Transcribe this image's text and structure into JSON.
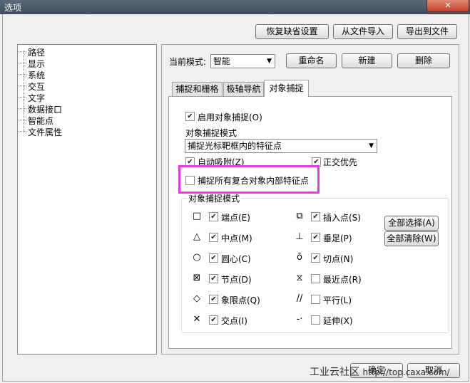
{
  "window": {
    "title": "选项",
    "close_glyph": "✕"
  },
  "top_buttons": {
    "restore": "恢复缺省设置",
    "import": "从文件导入",
    "export": "导出到文件"
  },
  "tree": {
    "items": [
      {
        "label": "路径"
      },
      {
        "label": "显示"
      },
      {
        "label": "系统"
      },
      {
        "label": "交互"
      },
      {
        "label": "文字"
      },
      {
        "label": "数据接口"
      },
      {
        "label": "智能点"
      },
      {
        "label": "文件属性"
      }
    ]
  },
  "mode": {
    "label": "当前模式:",
    "value": "智能",
    "rename": "重命名",
    "new": "新建",
    "delete": "删除"
  },
  "tabs": [
    {
      "label": "捕捉和栅格",
      "active": false
    },
    {
      "label": "极轴导航",
      "active": false
    },
    {
      "label": "对象捕捉",
      "active": true
    }
  ],
  "snap": {
    "enable_label": "启用对象捕捉(O)",
    "enable_checked": true,
    "mode_label": "对象捕捉模式",
    "mode_value": "捕捉光标靶框内的特征点",
    "auto_label": "自动吸附(Z)",
    "auto_checked": true,
    "ortho_label": "正交优先",
    "ortho_checked": true,
    "compound_label": "捕捉所有复合对象内部特征点",
    "compound_checked": false,
    "group_title": "对象捕捉模式",
    "select_all": "全部选择(A)",
    "clear_all": "全部清除(W)",
    "left_modes": [
      {
        "symbol": "□",
        "icon": "square-icon",
        "label": "端点(E)",
        "checked": true
      },
      {
        "symbol": "△",
        "icon": "triangle-icon",
        "label": "中点(M)",
        "checked": true
      },
      {
        "symbol": "○",
        "icon": "circle-icon",
        "label": "圆心(C)",
        "checked": true
      },
      {
        "symbol": "⊠",
        "icon": "node-icon",
        "label": "节点(D)",
        "checked": true
      },
      {
        "symbol": "◇",
        "icon": "diamond-icon",
        "label": "象限点(Q)",
        "checked": true
      },
      {
        "symbol": "✕",
        "icon": "cross-icon",
        "label": "交点(I)",
        "checked": true
      }
    ],
    "right_modes": [
      {
        "symbol": "⧉",
        "icon": "insert-icon",
        "label": "插入点(S)",
        "checked": true
      },
      {
        "symbol": "⊥",
        "icon": "perpendicular-icon",
        "label": "垂足(P)",
        "checked": true
      },
      {
        "symbol": "ō",
        "icon": "tangent-icon",
        "label": "切点(N)",
        "checked": true
      },
      {
        "symbol": "⧖",
        "icon": "nearest-icon",
        "label": "最近点(R)",
        "checked": false
      },
      {
        "symbol": "//",
        "icon": "parallel-icon",
        "label": "平行(L)",
        "checked": false
      },
      {
        "symbol": "-·",
        "icon": "extension-icon",
        "label": "延伸(X)",
        "checked": false
      }
    ]
  },
  "bottom_buttons": {
    "ok": "确定",
    "cancel": "取消"
  },
  "watermark": {
    "text": "工业云社区",
    "url": "http://top.caxa.com/"
  },
  "colors": {
    "highlight": "#e83ce0",
    "check": "#1e1e1e"
  }
}
